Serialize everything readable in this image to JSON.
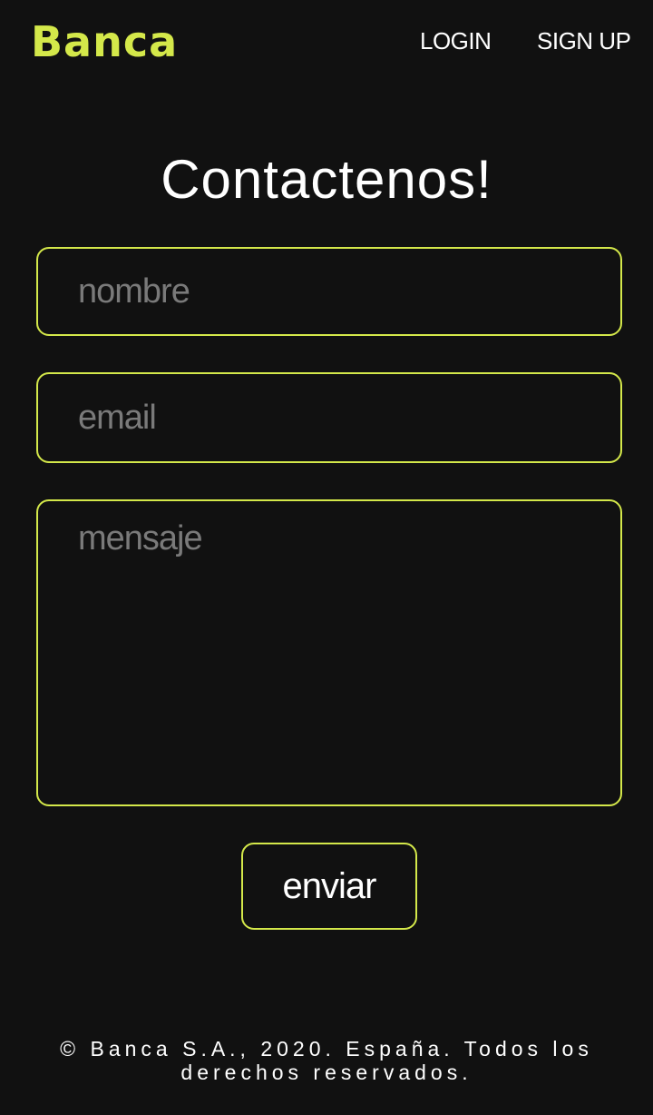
{
  "header": {
    "logo_text": "Banca",
    "nav": {
      "login_label": "LOGIN",
      "signup_label": "SIGN UP"
    }
  },
  "main": {
    "title": "Contactenos!",
    "form": {
      "nombre_placeholder": "nombre",
      "nombre_value": "",
      "email_placeholder": "email",
      "email_value": "",
      "mensaje_placeholder": "mensaje",
      "mensaje_value": "",
      "submit_label": "enviar"
    }
  },
  "footer": {
    "copyright": "© Banca S.A., 2020. España. Todos los derechos reservados."
  },
  "colors": {
    "background": "#111111",
    "accent": "#d4e84a",
    "text": "#ffffff",
    "placeholder": "#7a7a7a"
  }
}
